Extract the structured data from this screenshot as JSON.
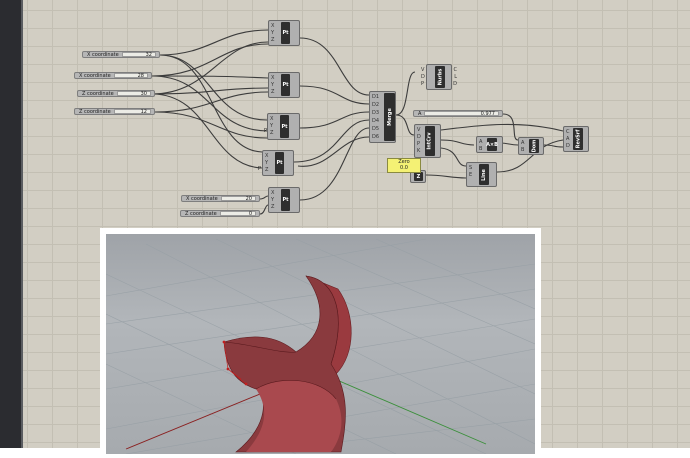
{
  "app": {
    "name": "Grasshopper canvas"
  },
  "sliders": [
    {
      "label": "X coordinate",
      "value": "32"
    },
    {
      "label": "X coordinate",
      "value": "28"
    },
    {
      "label": "Z coordinate",
      "value": "30"
    },
    {
      "label": "Z coordinate",
      "value": "12"
    },
    {
      "label": "X coordinate",
      "value": "20"
    },
    {
      "label": "Z coordinate",
      "value": "0"
    }
  ],
  "a_slider": {
    "label": "A",
    "value": "0.977"
  },
  "zero_panel": {
    "label": "Zero",
    "value": "0.0"
  },
  "components": {
    "pt": {
      "name": "Pt",
      "inputs": [
        "X",
        "Y",
        "Z"
      ],
      "output": "Pt"
    },
    "merge": {
      "name": "Merge",
      "inputs": [
        "D1",
        "D2",
        "D3",
        "D4",
        "D5",
        "D6"
      ],
      "output": "R"
    },
    "nurbs": {
      "name": "Nurbs",
      "inputs": [
        "V",
        "D",
        "P"
      ],
      "outputs": [
        "C",
        "L",
        "D"
      ]
    },
    "intcrv": {
      "name": "IntCrv",
      "inputs": [
        "V",
        "D",
        "P",
        "K"
      ],
      "outputs": [
        "C",
        "L",
        "D"
      ]
    },
    "axb": {
      "name": "A×B",
      "inputs": [
        "A",
        "B"
      ],
      "output": "R"
    },
    "line": {
      "name": "Line",
      "inputs": [
        "S",
        "E"
      ],
      "output": "L"
    },
    "z": {
      "name": "Z"
    },
    "dom": {
      "name": "Dom",
      "inputs": [
        "A",
        "B"
      ],
      "output": "I"
    },
    "revsrf": {
      "name": "RevSrf",
      "inputs": [
        "C",
        "A",
        "D"
      ],
      "output": "S"
    }
  },
  "port_label": "P",
  "viewport": {
    "name": "Rhino perspective viewport",
    "surface_color": "#8a3a3e"
  }
}
